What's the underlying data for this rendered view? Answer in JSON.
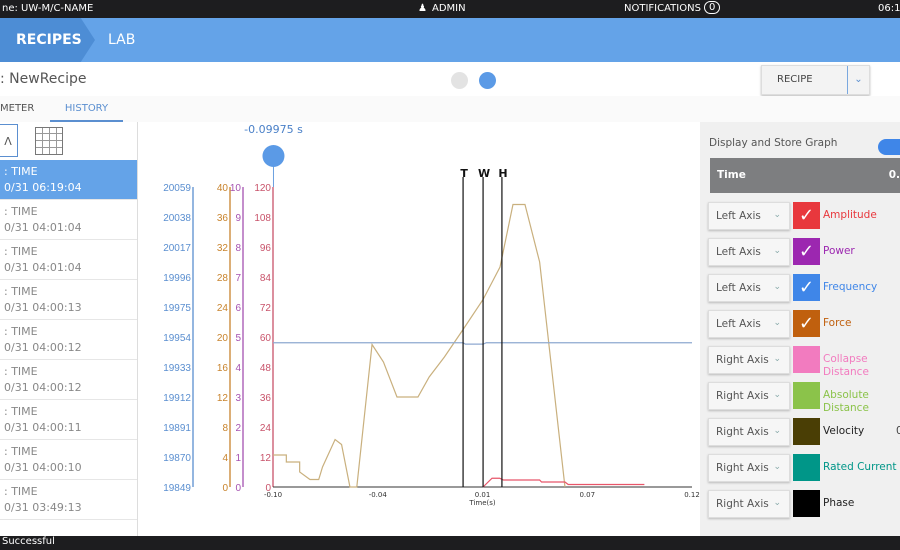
{
  "topbar": {
    "machine": "ne: UW-M/C-NAME",
    "user": "ADMIN",
    "notifications_label": "NOTIFICATIONS",
    "notifications_count": "0",
    "time": "06:1"
  },
  "nav": {
    "crumbs": [
      "RECIPES",
      "LAB"
    ]
  },
  "subheader": {
    "recipe_name": ": NewRecipe",
    "dropdown": "RECIPE"
  },
  "tabs": [
    "METER",
    "HISTORY"
  ],
  "sidebar": {
    "items": [
      {
        "title": ": TIME",
        "date": "0/31 06:19:04",
        "selected": true
      },
      {
        "title": ": TIME",
        "date": "0/31 04:01:04"
      },
      {
        "title": ": TIME",
        "date": "0/31 04:01:04"
      },
      {
        "title": ": TIME",
        "date": "0/31 04:00:13"
      },
      {
        "title": ": TIME",
        "date": "0/31 04:00:12"
      },
      {
        "title": ": TIME",
        "date": "0/31 04:00:12"
      },
      {
        "title": ": TIME",
        "date": "0/31 04:00:11"
      },
      {
        "title": ": TIME",
        "date": "0/31 04:00:10"
      },
      {
        "title": ": TIME",
        "date": "0/31 03:49:13"
      }
    ]
  },
  "status": "Successful",
  "right_panel": {
    "display_store_label": "Display and Store Graph",
    "toggle_on": true,
    "time_label": "Time",
    "time_value": "0.",
    "series": [
      {
        "axis": "Left Axis",
        "name": "Amplitude",
        "color": "#e8383d",
        "checked": true
      },
      {
        "axis": "Left Axis",
        "name": "Power",
        "color": "#9c27b0",
        "checked": true
      },
      {
        "axis": "Left Axis",
        "name": "Frequency",
        "color": "#3f86e8",
        "checked": true
      },
      {
        "axis": "Left Axis",
        "name": "Force",
        "color": "#c0600e",
        "checked": true
      },
      {
        "axis": "Right Axis",
        "name": "Collapse Distance",
        "color": "#f27bbf",
        "checked": false
      },
      {
        "axis": "Right Axis",
        "name": "Absolute Distance",
        "color": "#8bc34a",
        "checked": false
      },
      {
        "axis": "Right Axis",
        "name": "Velocity",
        "color": "#4a3e05",
        "checked": false,
        "value": "0"
      },
      {
        "axis": "Right Axis",
        "name": "Rated Current",
        "color": "#009688",
        "checked": false
      },
      {
        "axis": "Right Axis",
        "name": "Phase",
        "color": "#000000",
        "checked": false
      }
    ]
  },
  "chart_data": {
    "type": "line",
    "cursor_label": "-0.09975 s",
    "cursor_time": -0.09975,
    "xlabel": "Time(s)",
    "xlim": [
      -0.1,
      0.12
    ],
    "xticks": [
      "-0.10",
      "-0.04",
      "0.01",
      "0.07",
      "0.12"
    ],
    "markers": [
      {
        "label": "T",
        "x": -0.0002
      },
      {
        "label": "W",
        "x": 0.0103
      },
      {
        "label": "H",
        "x": 0.0202
      }
    ],
    "axes": [
      {
        "name": "Frequency",
        "color": "#5b8fd0",
        "ticks": [
          "19849",
          "19870",
          "19891",
          "19912",
          "19933",
          "19954",
          "19975",
          "19996",
          "20017",
          "20038",
          "20059"
        ]
      },
      {
        "name": "Force",
        "color": "#c8832c",
        "ticks": [
          "0",
          "4",
          "8",
          "12",
          "16",
          "20",
          "24",
          "28",
          "32",
          "36",
          "40"
        ]
      },
      {
        "name": "Power",
        "color": "#a552b0",
        "ticks": [
          "0",
          "1",
          "2",
          "3",
          "4",
          "5",
          "6",
          "7",
          "8",
          "9",
          "10"
        ]
      },
      {
        "name": "Amplitude",
        "color": "#c8536a",
        "ticks": [
          "0",
          "12",
          "24",
          "36",
          "48",
          "60",
          "72",
          "84",
          "96",
          "108",
          "120"
        ]
      }
    ],
    "series": [
      {
        "name": "Force",
        "axis": "Amplitude scale 0-120",
        "color": "#c9b07e",
        "points": [
          [
            -0.1,
            12.8
          ],
          [
            -0.093,
            12.8
          ],
          [
            -0.093,
            10
          ],
          [
            -0.086,
            10
          ],
          [
            -0.086,
            6
          ],
          [
            -0.0806,
            3
          ],
          [
            -0.076,
            3
          ],
          [
            -0.074,
            8
          ],
          [
            -0.0674,
            19
          ],
          [
            -0.064,
            17
          ],
          [
            -0.0596,
            0
          ],
          [
            -0.056,
            0
          ],
          [
            -0.048,
            57
          ],
          [
            -0.042,
            50
          ],
          [
            -0.0349,
            36
          ],
          [
            -0.0239,
            36
          ],
          [
            -0.018,
            44
          ],
          [
            -0.01,
            52
          ],
          [
            -0.0002,
            63
          ],
          [
            0.0103,
            75
          ],
          [
            0.0192,
            88
          ],
          [
            0.026,
            113
          ],
          [
            0.0323,
            113
          ],
          [
            0.04,
            90
          ],
          [
            0.0533,
            0
          ]
        ]
      },
      {
        "name": "Frequency",
        "color": "#8fa9d0",
        "points": [
          [
            -0.1,
            19950
          ],
          [
            -0.0002,
            19950
          ],
          [
            0.001,
            19949
          ],
          [
            0.0103,
            19949
          ],
          [
            0.012,
            19950
          ],
          [
            0.12,
            19950
          ]
        ]
      },
      {
        "name": "Amplitude",
        "color": "#e8566a",
        "points": [
          [
            0.0103,
            0
          ],
          [
            0.015,
            3.5
          ],
          [
            0.019,
            3.5
          ],
          [
            0.021,
            2.8
          ],
          [
            0.04,
            2.8
          ],
          [
            0.041,
            2
          ],
          [
            0.0533,
            2
          ],
          [
            0.055,
            1
          ],
          [
            0.095,
            1
          ]
        ]
      }
    ]
  }
}
